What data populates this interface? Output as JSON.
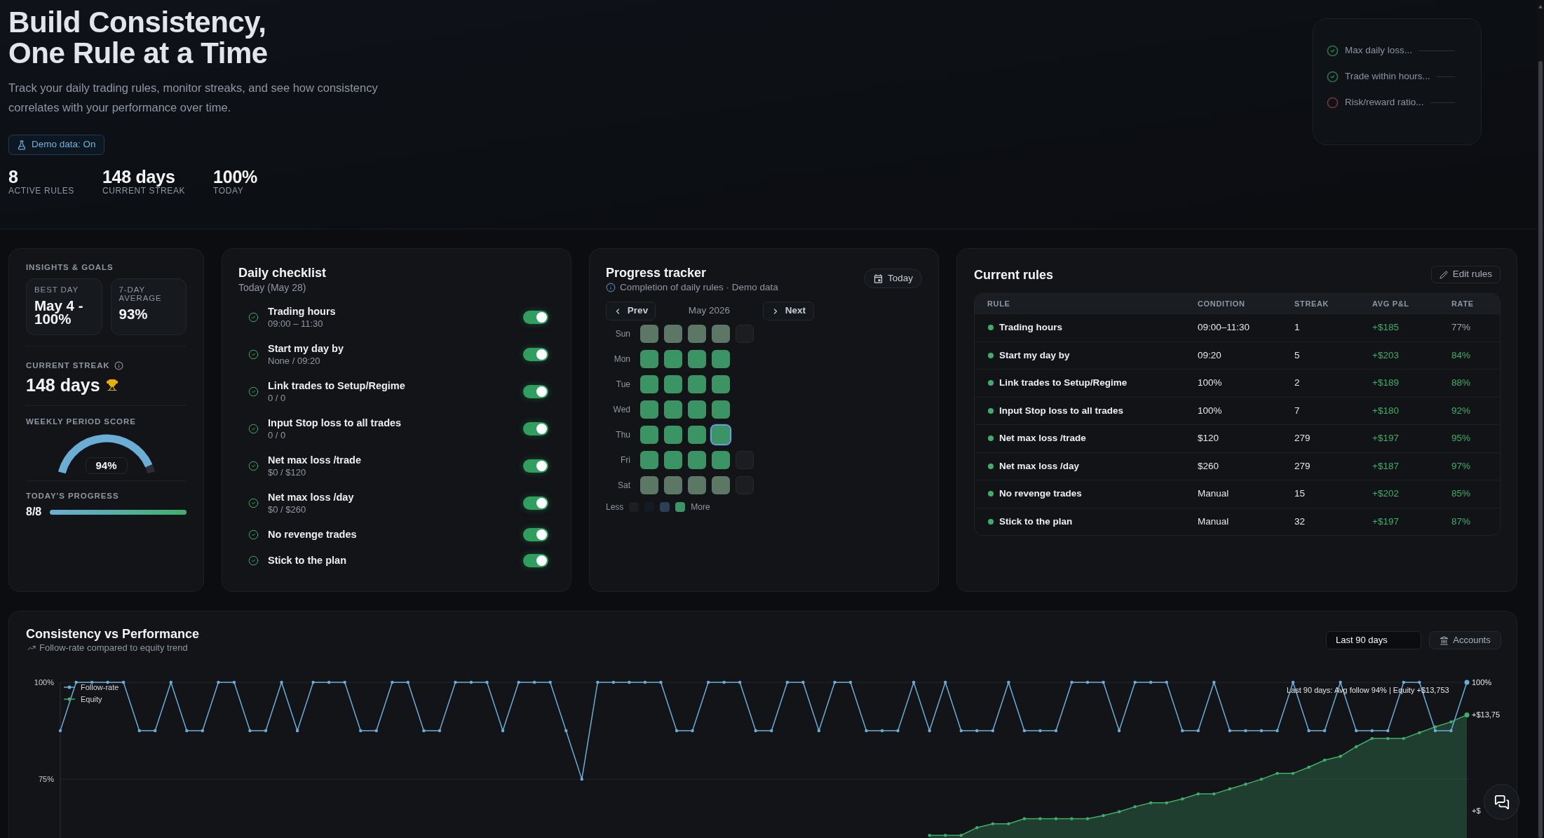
{
  "header": {
    "title": "Build Consistency, One Rule at a Time",
    "subtitle": "Track your daily trading rules, monitor streaks, and see how consistency correlates with your performance over time.",
    "demo_button": "Demo data: On",
    "stats": [
      {
        "value": "8",
        "label": "ACTIVE RULES"
      },
      {
        "value": "148 days",
        "label": "CURRENT STREAK"
      },
      {
        "value": "100%",
        "label": "TODAY"
      }
    ]
  },
  "preview_card": {
    "items": [
      {
        "text": "Max daily loss...",
        "done": true
      },
      {
        "text": "Trade within hours...",
        "done": true
      },
      {
        "text": "Risk/reward ratio...",
        "done": false
      }
    ]
  },
  "insights": {
    "heading": "INSIGHTS & GOALS",
    "tiles": [
      {
        "label": "BEST DAY",
        "value": "May 4 - 100%"
      },
      {
        "label": "7-DAY AVERAGE",
        "value": "93%"
      }
    ],
    "streak": {
      "label": "CURRENT STREAK",
      "value": "148 days"
    },
    "weekly_score": {
      "label": "WEEKLY PERIOD SCORE",
      "value": "94%",
      "level": 0.94
    },
    "progress": {
      "label": "TODAY'S PROGRESS",
      "value": "8/8",
      "level": 1
    }
  },
  "checklist": {
    "title": "Daily checklist",
    "subtitle": "Today (May 28)",
    "items": [
      {
        "label": "Trading hours",
        "detail": "09:00 – 11:30",
        "done": true,
        "on": true
      },
      {
        "label": "Start my day by",
        "detail": "None / 09:20",
        "done": true,
        "on": true
      },
      {
        "label": "Link trades to Setup/Regime",
        "detail": "0 / 0",
        "done": true,
        "on": true
      },
      {
        "label": "Input Stop loss to all trades",
        "detail": "0 / 0",
        "done": true,
        "on": true
      },
      {
        "label": "Net max loss /trade",
        "detail": "$0 / $120",
        "done": true,
        "on": true
      },
      {
        "label": "Net max loss /day",
        "detail": "$0 / $260",
        "done": true,
        "on": true
      },
      {
        "label": "No revenge trades",
        "done": true,
        "on": true
      },
      {
        "label": "Stick to the plan",
        "done": true,
        "on": true
      }
    ]
  },
  "tracker": {
    "title": "Progress tracker",
    "subtitle": "Completion of daily rules · Demo data",
    "today_button": "Today",
    "prev_button": "Prev",
    "month": "May 2026",
    "next_button": "Next",
    "days": [
      {
        "label": "Sun",
        "cells": [
          {
            "kind": "rest",
            "selected": false
          },
          {
            "kind": "rest",
            "selected": false
          },
          {
            "kind": "rest",
            "selected": false
          },
          {
            "kind": "rest",
            "selected": false
          },
          {
            "kind": "future",
            "selected": false
          }
        ]
      },
      {
        "label": "Mon",
        "cells": [
          {
            "kind": "complete",
            "selected": false
          },
          {
            "kind": "complete",
            "selected": false
          },
          {
            "kind": "complete",
            "selected": false
          },
          {
            "kind": "complete",
            "selected": false
          }
        ]
      },
      {
        "label": "Tue",
        "cells": [
          {
            "kind": "complete",
            "selected": false
          },
          {
            "kind": "complete",
            "selected": false
          },
          {
            "kind": "complete",
            "selected": false
          },
          {
            "kind": "complete",
            "selected": false
          }
        ]
      },
      {
        "label": "Wed",
        "cells": [
          {
            "kind": "complete",
            "selected": false
          },
          {
            "kind": "complete",
            "selected": false
          },
          {
            "kind": "complete",
            "selected": false
          },
          {
            "kind": "complete",
            "selected": false
          }
        ]
      },
      {
        "label": "Thu",
        "cells": [
          {
            "kind": "complete",
            "selected": false
          },
          {
            "kind": "complete",
            "selected": false
          },
          {
            "kind": "complete",
            "selected": false
          },
          {
            "kind": "complete",
            "selected": true
          }
        ]
      },
      {
        "label": "Fri",
        "cells": [
          {
            "kind": "complete",
            "selected": false
          },
          {
            "kind": "complete",
            "selected": false
          },
          {
            "kind": "complete",
            "selected": false
          },
          {
            "kind": "complete",
            "selected": false
          },
          {
            "kind": "future",
            "selected": false
          }
        ]
      },
      {
        "label": "Sat",
        "cells": [
          {
            "kind": "rest",
            "selected": false
          },
          {
            "kind": "rest",
            "selected": false
          },
          {
            "kind": "rest",
            "selected": false
          },
          {
            "kind": "rest",
            "selected": false
          },
          {
            "kind": "future",
            "selected": false
          }
        ]
      }
    ],
    "legend": {
      "less": "Less",
      "more": "More",
      "swatches": [
        {
          "color": "#1c1e22"
        },
        {
          "color": "#151b23"
        },
        {
          "color": "#2b3f58"
        },
        {
          "color": "#3a9464"
        }
      ]
    }
  },
  "rules": {
    "title": "Current rules",
    "edit_button": "Edit rules",
    "columns": [
      "RULE",
      "CONDITION",
      "STREAK",
      "AVG P&L",
      "RATE"
    ],
    "rows": [
      {
        "rule": "Trading hours",
        "condition": "09:00–11:30",
        "streak": "1",
        "avg_pnl": "+$185",
        "rate": "77%",
        "active": true,
        "rate_good": false
      },
      {
        "rule": "Start my day by",
        "condition": "09:20",
        "streak": "5",
        "avg_pnl": "+$203",
        "rate": "84%",
        "active": true,
        "rate_good": true
      },
      {
        "rule": "Link trades to Setup/Regime",
        "condition": "100%",
        "streak": "2",
        "avg_pnl": "+$189",
        "rate": "88%",
        "active": true,
        "rate_good": true
      },
      {
        "rule": "Input Stop loss to all trades",
        "condition": "100%",
        "streak": "7",
        "avg_pnl": "+$180",
        "rate": "92%",
        "active": true,
        "rate_good": true
      },
      {
        "rule": "Net max loss /trade",
        "condition": "$120",
        "streak": "279",
        "avg_pnl": "+$197",
        "rate": "95%",
        "active": true,
        "rate_good": true
      },
      {
        "rule": "Net max loss /day",
        "condition": "$260",
        "streak": "279",
        "avg_pnl": "+$187",
        "rate": "97%",
        "active": true,
        "rate_good": true
      },
      {
        "rule": "No revenge trades",
        "condition": "Manual",
        "streak": "15",
        "avg_pnl": "+$202",
        "rate": "85%",
        "active": true,
        "rate_good": true
      },
      {
        "rule": "Stick to the plan",
        "condition": "Manual",
        "streak": "32",
        "avg_pnl": "+$197",
        "rate": "87%",
        "active": true,
        "rate_good": true
      }
    ]
  },
  "chart": {
    "title": "Consistency vs Performance",
    "subtitle": "Follow-rate compared to equity trend",
    "range_select": "Last 90 days",
    "accounts_button": "Accounts",
    "chart_data": {
      "type": "line",
      "legend": "upper left",
      "ylim": [
        60,
        100
      ],
      "yticks": [
        {
          "value": 75,
          "label": "75%"
        },
        {
          "value": 100,
          "label": "100%"
        }
      ],
      "series": [
        {
          "name": "Follow-rate",
          "color": "#6aaed6",
          "values": [
            87.5,
            100,
            100,
            100,
            100,
            87.5,
            87.5,
            100,
            87.5,
            87.5,
            100,
            100,
            87.5,
            87.5,
            100,
            87.5,
            100,
            100,
            100,
            87.5,
            87.5,
            100,
            100,
            87.5,
            87.5,
            100,
            100,
            100,
            87.5,
            100,
            100,
            100,
            87.5,
            75,
            100,
            100,
            100,
            100,
            100,
            87.5,
            87.5,
            100,
            100,
            100,
            87.5,
            87.5,
            100,
            100,
            87.5,
            100,
            100,
            87.5,
            87.5,
            87.5,
            100,
            87.5,
            100,
            87.5,
            87.5,
            87.5,
            100,
            87.5,
            87.5,
            87.5,
            100,
            100,
            100,
            87.5,
            100,
            100,
            100,
            87.5,
            87.5,
            100,
            87.5,
            87.5,
            87.5,
            87.5,
            100,
            87.5,
            87.5,
            100,
            87.5,
            87.5,
            87.5,
            100,
            100,
            87.5,
            87.5,
            100
          ]
        },
        {
          "name": "Equity",
          "color": "#3fae6a",
          "values": [
            null,
            null,
            null,
            null,
            null,
            null,
            null,
            null,
            null,
            null,
            null,
            null,
            null,
            null,
            null,
            null,
            null,
            null,
            null,
            null,
            null,
            null,
            null,
            null,
            null,
            null,
            null,
            null,
            null,
            null,
            null,
            null,
            null,
            null,
            null,
            null,
            null,
            null,
            null,
            null,
            null,
            null,
            null,
            null,
            null,
            null,
            null,
            null,
            null,
            null,
            null,
            null,
            null,
            null,
            null,
            60.5,
            60.5,
            60.5,
            62.5,
            63.5,
            63.5,
            64.8,
            64.8,
            64.8,
            64.8,
            64.8,
            65.6,
            66.6,
            67.9,
            68.9,
            68.9,
            69.9,
            71.2,
            71.2,
            72.5,
            73.7,
            75,
            76.5,
            76.5,
            78.1,
            79.9,
            80.9,
            83.4,
            85.5,
            85.5,
            85.5,
            87,
            88.5,
            89.8,
            91.6
          ]
        }
      ],
      "annotations": [
        "Last 90 days: Avg follow 94% | Equity +$13,753",
        "100%",
        "+$13,75",
        "+$"
      ]
    }
  }
}
